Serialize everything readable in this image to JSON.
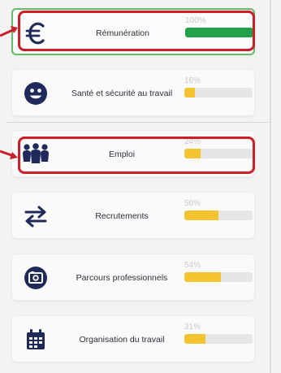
{
  "colors": {
    "accent_red": "#cc1f2a",
    "progress_green": "#22a04b",
    "progress_yellow": "#f4c430",
    "icon_navy": "#1f2a5a",
    "selected_border": "#66bb6a"
  },
  "cards": [
    {
      "icon": "euro-icon",
      "label": "Rémunération",
      "percent_text": "100%",
      "progress": 1.0,
      "state": "selected"
    },
    {
      "icon": "smiley-icon",
      "label": "Santé et sécurité au travail",
      "percent_text": "16%",
      "progress": 0.16
    },
    {
      "icon": "people-icon",
      "label": "Emploi",
      "percent_text": "24%",
      "progress": 0.24
    },
    {
      "icon": "arrows-exchange-icon",
      "label": "Recrutements",
      "percent_text": "50%",
      "progress": 0.5
    },
    {
      "icon": "photo-id-icon",
      "label": "Parcours professionnels",
      "percent_text": "54%",
      "progress": 0.54
    },
    {
      "icon": "calendar-icon",
      "label": "Organisation du travail",
      "percent_text": "31%",
      "progress": 0.31
    }
  ]
}
